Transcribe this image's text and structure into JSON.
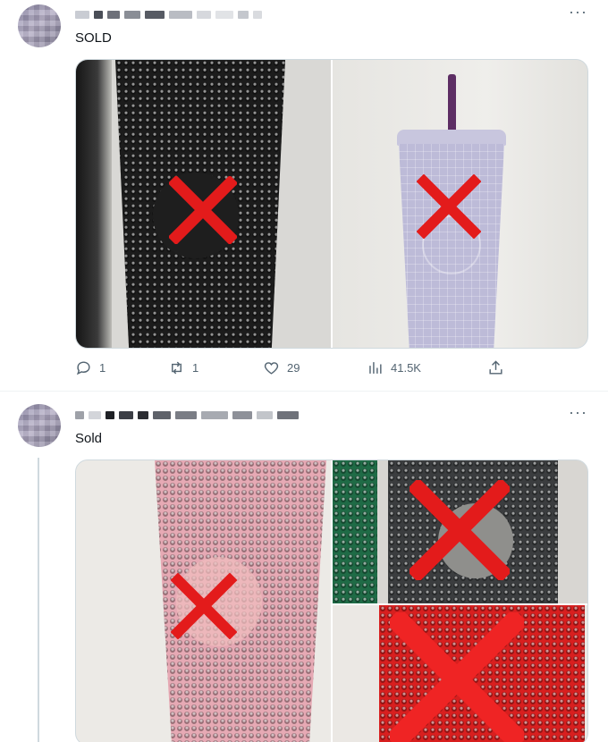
{
  "tweets": [
    {
      "text": "SOLD",
      "more_icon": "more-horizontal-icon",
      "actions": {
        "replies": "1",
        "retweets": "1",
        "likes": "29",
        "views": "41.5K"
      }
    },
    {
      "text": "Sold",
      "more_icon": "more-horizontal-icon"
    }
  ],
  "colors": {
    "text_primary": "#0f1419",
    "text_secondary": "#536471",
    "border": "#cfd9de",
    "x_mark": "#e31b1b"
  }
}
